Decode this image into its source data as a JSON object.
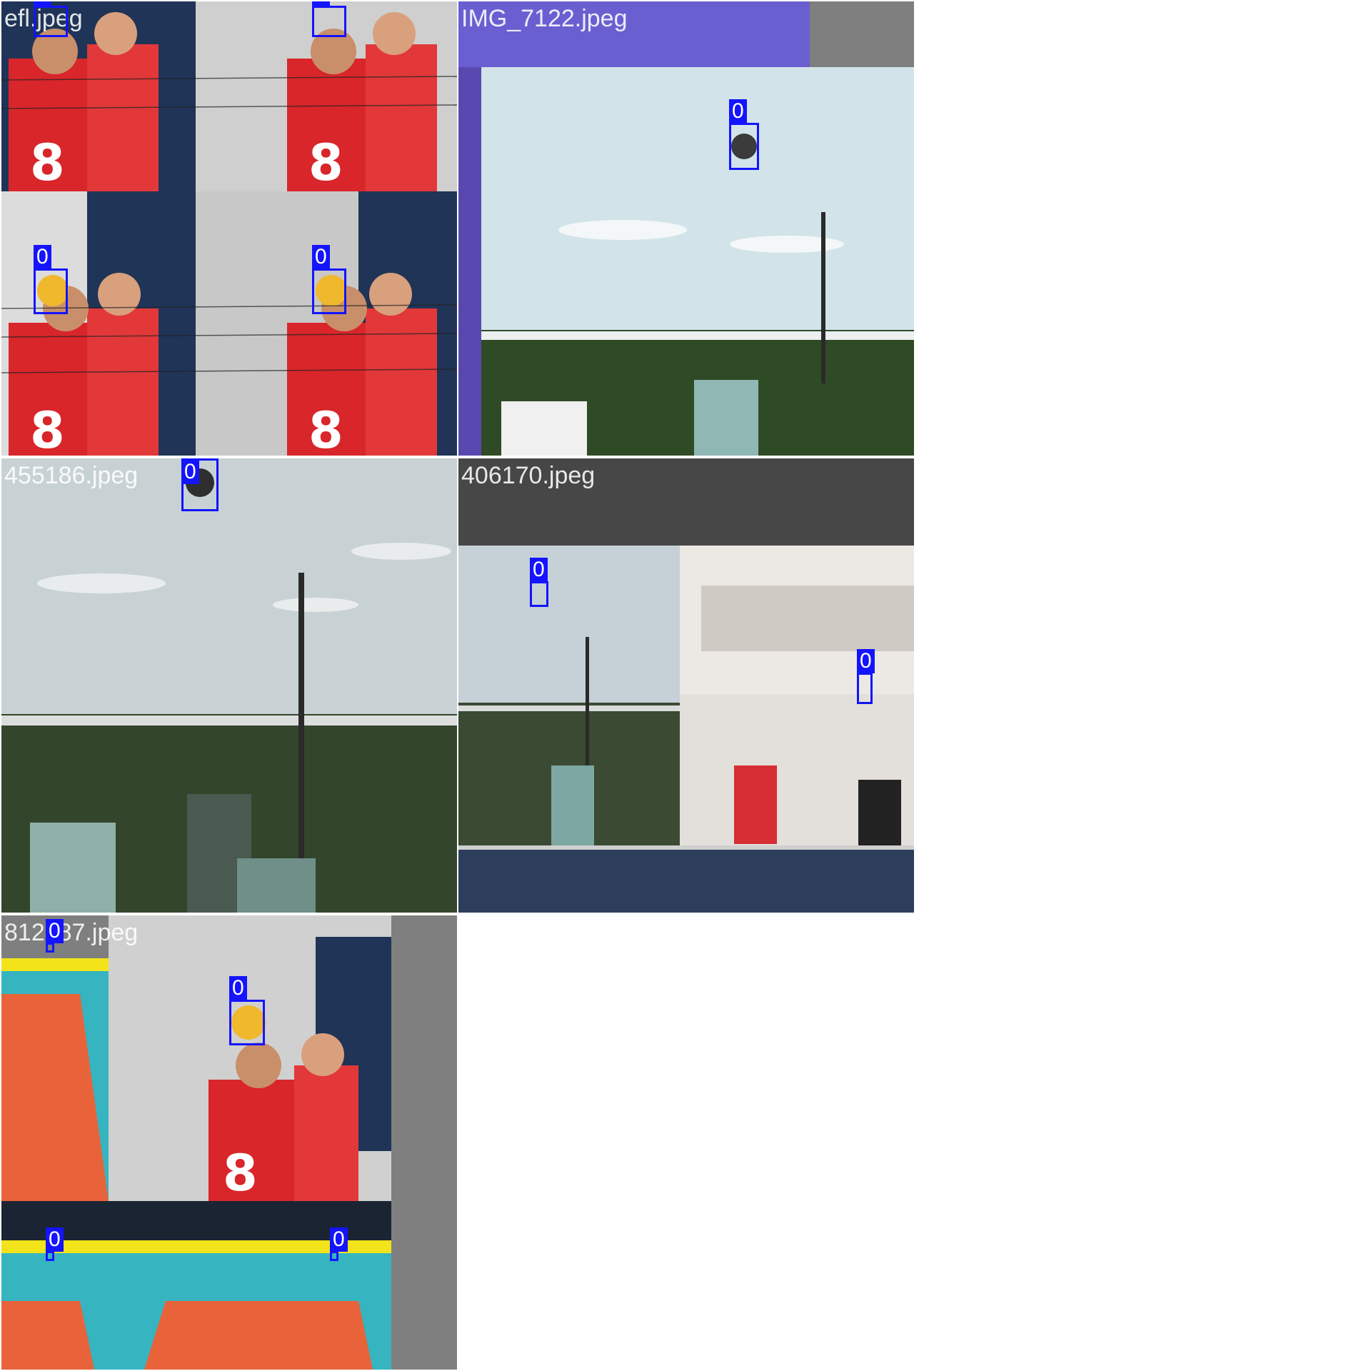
{
  "tiles": [
    {
      "label": "efl.jpeg"
    },
    {
      "label": "IMG_7122.jpeg"
    },
    {
      "label": "455186.jpeg"
    },
    {
      "label": "406170.jpeg"
    },
    {
      "label": "812187.jpeg"
    }
  ],
  "detection_class": "0",
  "colors": {
    "box": "#1414ff",
    "sky": "#cfe0e8",
    "jersey": "#d8262a",
    "court": "#e8633a",
    "floor": "#36b4c0",
    "pad": "#808080"
  }
}
